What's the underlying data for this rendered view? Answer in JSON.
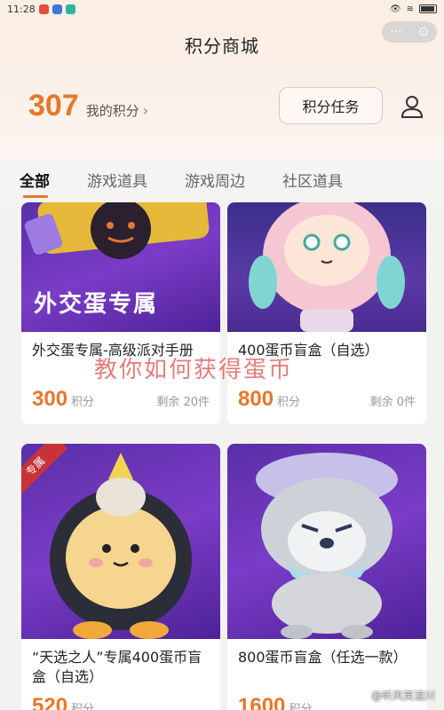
{
  "status_bar": {
    "time": "11:28",
    "battery": ""
  },
  "header": {
    "title": "积分商城",
    "capsule_more": "···",
    "capsule_close": "⊙"
  },
  "points": {
    "value": "307",
    "label": "我的积分",
    "chevron": "›"
  },
  "task_button": "积分任务",
  "tabs": [
    {
      "label": "全部",
      "active": true
    },
    {
      "label": "游戏道具",
      "active": false
    },
    {
      "label": "游戏周边",
      "active": false
    },
    {
      "label": "社区道具",
      "active": false
    }
  ],
  "products": [
    {
      "name": "外交蛋专属-高级派对手册",
      "price": "300",
      "unit": "积分",
      "remain": "剩余 20件",
      "image_text": "外交蛋专属"
    },
    {
      "name": "400蛋币盲盒（自选）",
      "price": "800",
      "unit": "积分",
      "remain": "剩余 0件"
    },
    {
      "name": "“天选之人”专属400蛋币盲盒（自选）",
      "price": "520",
      "unit": "积分",
      "remain": "",
      "badge": "专属"
    },
    {
      "name": "800蛋币盲盒（任选一款）",
      "price": "1600",
      "unit": "积分",
      "remain": ""
    }
  ],
  "watermark": "教你如何获得蛋币",
  "credit": "@听风笑渲川",
  "colors": {
    "accent": "#e8772a",
    "card_bg_purple": "#6a35b8",
    "badge_red": "#c8333a"
  }
}
